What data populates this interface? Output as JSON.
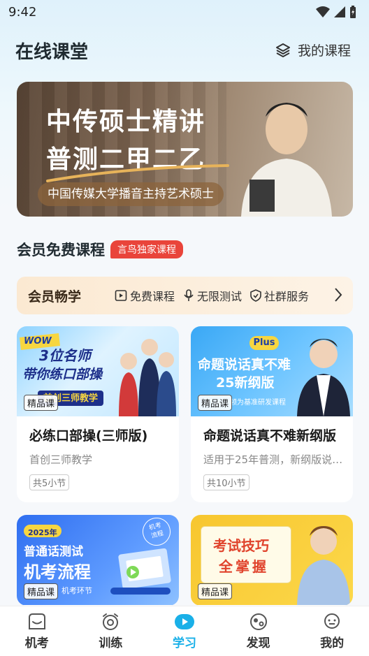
{
  "status_bar": {
    "time": "9:42"
  },
  "header": {
    "title": "在线课堂",
    "my_courses": "我的课程"
  },
  "banner": {
    "title_line1": "中传硕士精讲",
    "title_line2": "普测二甲二乙",
    "subtitle": "中国传媒大学播音主持艺术硕士"
  },
  "section": {
    "title": "会员免费课程",
    "badge": "言鸟独家课程"
  },
  "vip_bar": {
    "title": "会员畅学",
    "items": [
      {
        "label": "免费课程",
        "icon": "play-icon"
      },
      {
        "label": "无限测试",
        "icon": "mic-icon"
      },
      {
        "label": "社群服务",
        "icon": "shield-icon"
      }
    ]
  },
  "courses": [
    {
      "img_line1": "3位名师",
      "img_line2": "带你练口部操",
      "img_badge": "WOW",
      "img_footer": "首创三师教学",
      "tag": "精品课",
      "title": "必练口部操(三师版)",
      "desc": "首创三师教学",
      "count": "共5小节"
    },
    {
      "img_line1": "命题说话真不难",
      "img_line2": "25新纲版",
      "img_badge": "Plus",
      "img_footer": "领为基准研发课程",
      "tag": "精品课",
      "title": "命题说话真不难新纲版",
      "desc": "适用于25年普测，新纲版说话题目",
      "count": "共10小节"
    },
    {
      "img_line1": "普通话测试",
      "img_line2": "机考流程",
      "img_badge": "2025年",
      "img_footer": "机考环节",
      "img_stamp": "机考流程",
      "tag": "精品课"
    },
    {
      "img_line1": "考试技巧",
      "img_line2": "全掌握",
      "tag": "精品课"
    }
  ],
  "bottom_nav": [
    {
      "label": "机考",
      "icon": "exam-icon"
    },
    {
      "label": "训练",
      "icon": "alarm-icon"
    },
    {
      "label": "学习",
      "icon": "play-circle-icon",
      "active": true
    },
    {
      "label": "发现",
      "icon": "compass-icon"
    },
    {
      "label": "我的",
      "icon": "profile-icon"
    }
  ],
  "colors": {
    "accent": "#1ab0e8",
    "badge_red": "#e9443a"
  }
}
